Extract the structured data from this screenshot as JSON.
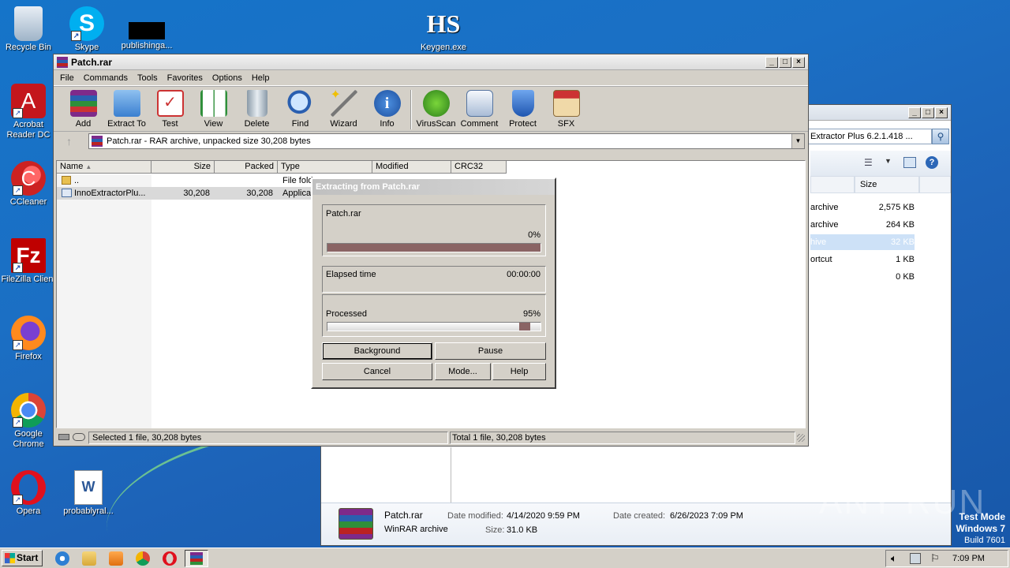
{
  "desktop": {
    "icons": [
      {
        "label": "Recycle Bin"
      },
      {
        "label": "Skype"
      },
      {
        "label": "publishinga..."
      },
      {
        "label": "Keygen.exe"
      },
      {
        "label": "Acrobat Reader DC"
      },
      {
        "label": "CCleaner"
      },
      {
        "label": "FileZilla Client"
      },
      {
        "label": "Firefox"
      },
      {
        "label": "Google Chrome"
      },
      {
        "label": "Opera"
      },
      {
        "label": "probablyral..."
      }
    ],
    "keygen_logo": "HS",
    "watermark": {
      "brand": "ANY RUN",
      "line1": "Test Mode",
      "line2": "Windows 7",
      "line3": "Build 7601"
    }
  },
  "winrar": {
    "title": "Patch.rar",
    "menu": [
      "File",
      "Commands",
      "Tools",
      "Favorites",
      "Options",
      "Help"
    ],
    "toolbar": [
      "Add",
      "Extract To",
      "Test",
      "View",
      "Delete",
      "Find",
      "Wizard",
      "Info",
      "VirusScan",
      "Comment",
      "Protect",
      "SFX"
    ],
    "address": "Patch.rar - RAR archive, unpacked size 30,208 bytes",
    "columns": [
      "Name",
      "Size",
      "Packed",
      "Type",
      "Modified",
      "CRC32"
    ],
    "rows": [
      {
        "name": "..",
        "size": "",
        "packed": "",
        "type": "File fold"
      },
      {
        "name": "InnoExtractorPlu...",
        "size": "30,208",
        "packed": "30,208",
        "type": "Applicat"
      }
    ],
    "status_left": "Selected 1 file, 30,208 bytes",
    "status_right": "Total 1 file, 30,208 bytes"
  },
  "extract_dialog": {
    "title": "Extracting from Patch.rar",
    "archive": "Patch.rar",
    "archive_percent": "0%",
    "archive_progress": 0,
    "elapsed_label": "Elapsed time",
    "elapsed_value": "00:00:00",
    "processed_label": "Processed",
    "processed_percent": "95%",
    "processed_progress": 0.95,
    "buttons": [
      "Background",
      "Pause",
      "Cancel",
      "Mode...",
      "Help"
    ]
  },
  "explorer": {
    "search_text": "Extractor Plus 6.2.1.418 ...",
    "size_header": "Size",
    "rows": [
      {
        "type": "archive",
        "size": "2,575 KB"
      },
      {
        "type": "archive",
        "size": "264 KB"
      },
      {
        "type": "hive",
        "size": "32 KB"
      },
      {
        "type": "ortcut",
        "size": "1 KB"
      },
      {
        "type": "",
        "size": "0 KB"
      }
    ],
    "details": {
      "name": "Patch.rar",
      "kind": "WinRAR archive",
      "modified_label": "Date modified:",
      "modified": "4/14/2020 9:59 PM",
      "size_label": "Size:",
      "size": "31.0 KB",
      "created_label": "Date created:",
      "created": "6/26/2023 7:09 PM"
    }
  },
  "taskbar": {
    "start": "Start",
    "clock": "7:09 PM"
  }
}
